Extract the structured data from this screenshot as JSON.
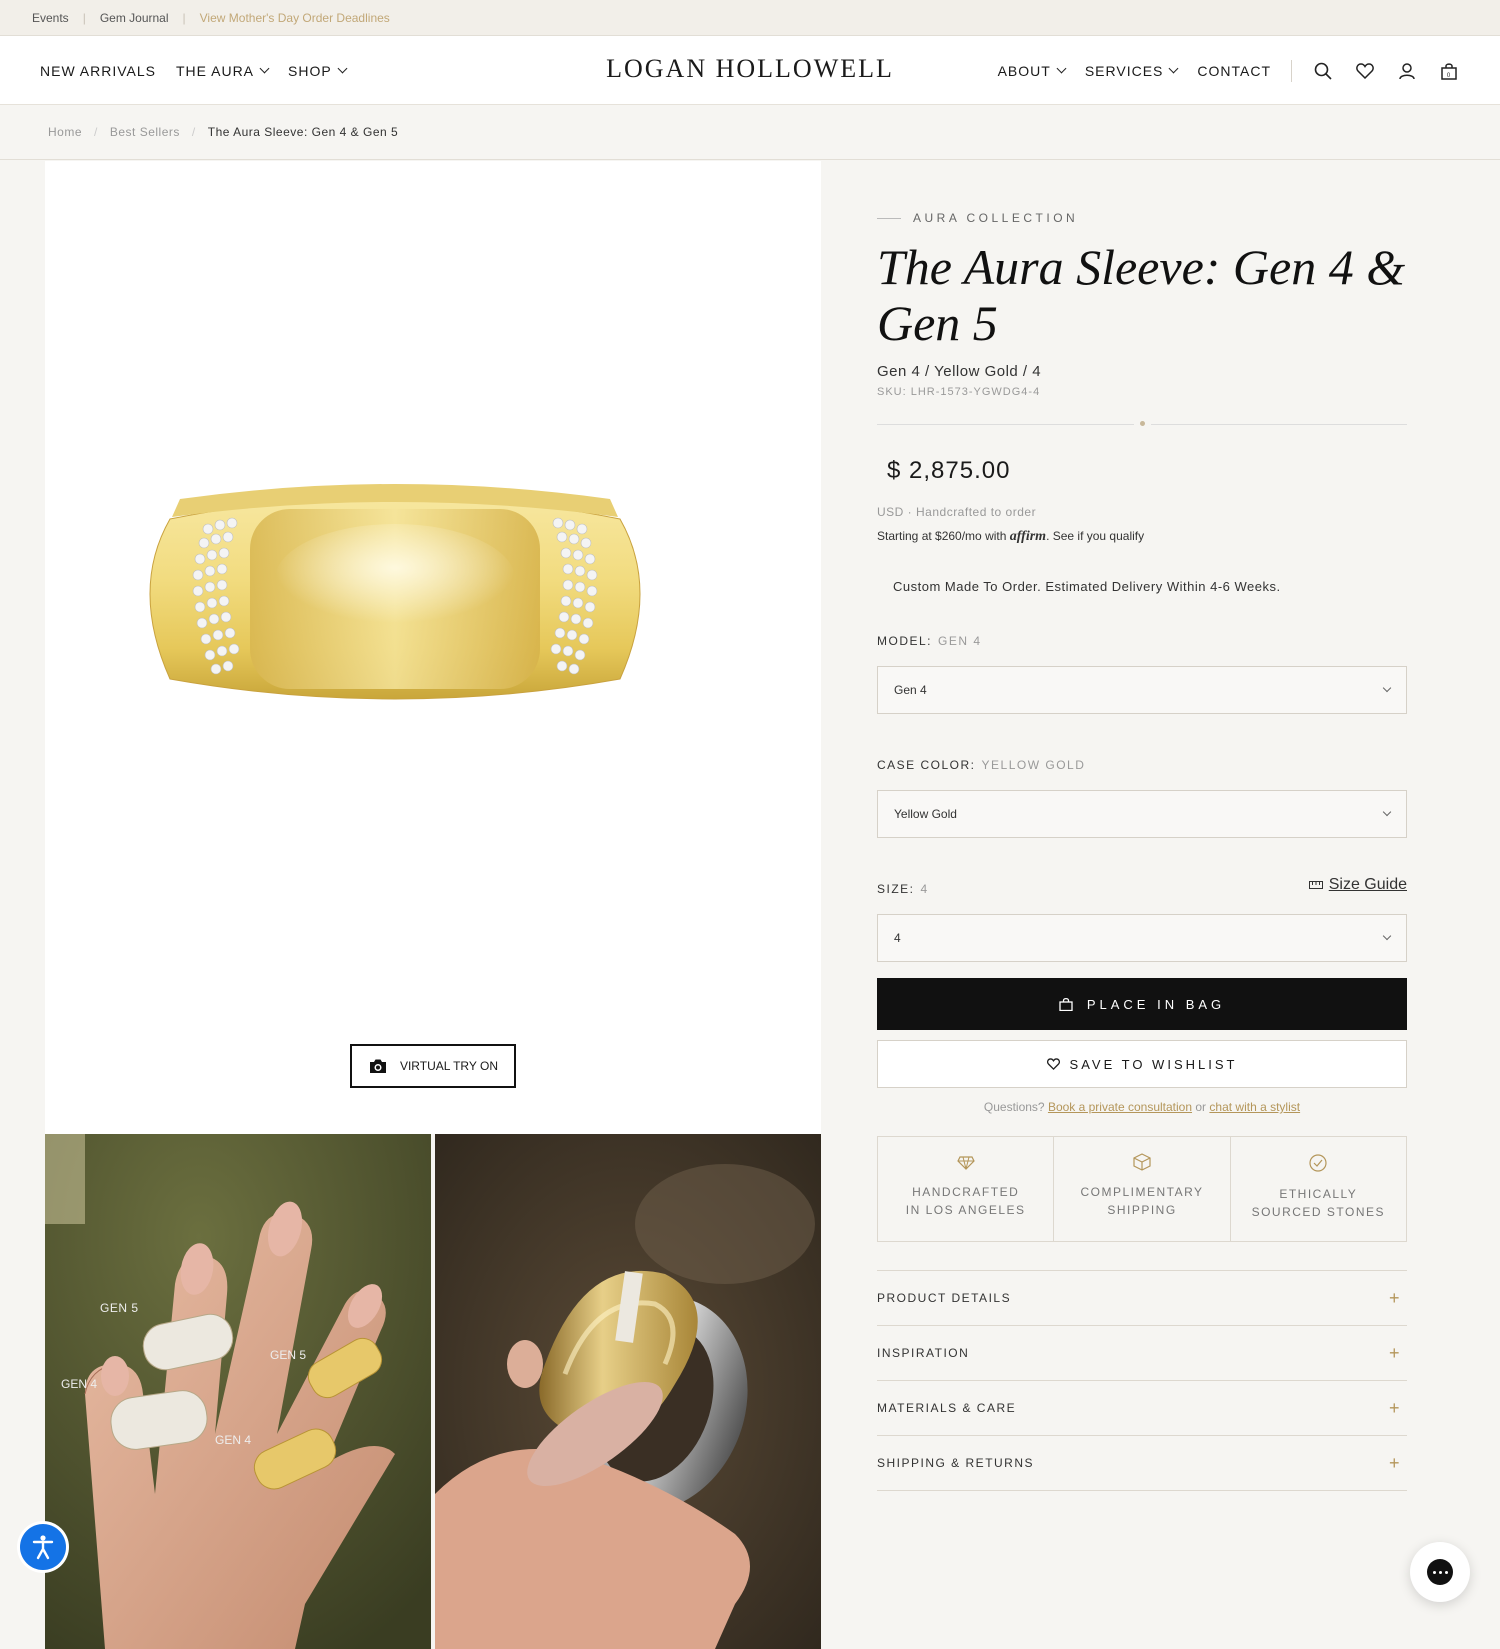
{
  "topbar": {
    "links": [
      "Events",
      "Gem Journal"
    ],
    "promo": "View Mother's Day Order Deadlines"
  },
  "header": {
    "logo": "LOGAN HOLLOWELL",
    "nav_left": [
      "NEW ARRIVALS",
      "THE AURA",
      "SHOP"
    ],
    "nav_right": [
      "ABOUT",
      "SERVICES",
      "CONTACT"
    ]
  },
  "breadcrumb": [
    "Home",
    "Best Sellers",
    "The Aura Sleeve: Gen 4 & Gen 5"
  ],
  "gallery": {
    "tryon_label": "VIRTUAL TRY ON",
    "thumb1_labels": [
      "GEN 5",
      "GEN 5",
      "GEN 4",
      "GEN 4"
    ]
  },
  "product": {
    "collection": "AURA COLLECTION",
    "title": "The Aura Sleeve: Gen 4 & Gen 5",
    "variant": "Gen 4 / Yellow Gold / 4",
    "sku": "SKU:  LHR-1573-YGWDG4-4",
    "price": "$ 2,875.00",
    "price_info": "USD · Handcrafted to order",
    "affirm_prefix": "Starting at $260/mo with",
    "affirm_brand": "affirm",
    "affirm_suffix": ". See if you qualify",
    "delivery": "Custom Made To Order. Estimated Delivery Within 4-6 Weeks.",
    "model_label": "MODEL:",
    "model_value": "GEN 4",
    "model_select": "Gen 4",
    "color_label": "CASE COLOR:",
    "color_value": "YELLOW GOLD",
    "color_select": "Yellow Gold",
    "size_label": "SIZE:",
    "size_value": "4",
    "size_select": "4",
    "size_guide": "Size Guide",
    "bag_button": "PLACE IN BAG",
    "wishlist_button": "SAVE TO WISHLIST",
    "questions_prefix": "Questions?",
    "consult_link": "Book a private consultation",
    "questions_or": "or",
    "stylist_link": "chat with a stylist",
    "features": [
      {
        "line1": "HANDCRAFTED",
        "line2": "IN LOS ANGELES"
      },
      {
        "line1": "COMPLIMENTARY",
        "line2": "SHIPPING"
      },
      {
        "line1": "ETHICALLY",
        "line2": "SOURCED STONES"
      }
    ],
    "accordion": [
      "PRODUCT DETAILS",
      "INSPIRATION",
      "MATERIALS & CARE",
      "SHIPPING & RETURNS"
    ]
  },
  "colors": {
    "background": "#f6f5f2",
    "accent_gold": "#b4965a",
    "button_black": "#111111",
    "a11y_blue": "#1473e6"
  }
}
